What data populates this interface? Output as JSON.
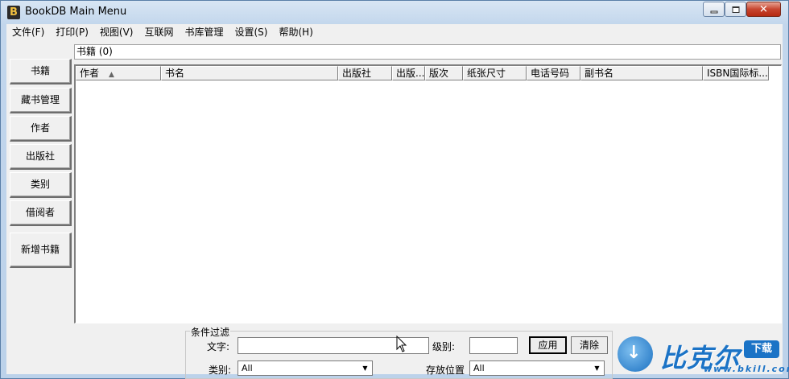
{
  "window": {
    "title": "BookDB Main Menu",
    "app_icon_letter": "B",
    "close_glyph": "✕"
  },
  "menu": [
    "文件(F)",
    "打印(P)",
    "视图(V)",
    "互联网",
    "书库管理",
    "设置(S)",
    "帮助(H)"
  ],
  "nav": [
    "书籍",
    "藏书管理",
    "作者",
    "出版社",
    "类别",
    "借阅者",
    "新增书籍"
  ],
  "list": {
    "caption": "书籍 (0)",
    "sort_indicator": "▲",
    "columns": [
      "作者",
      "书名",
      "出版社",
      "出版...",
      "版次",
      "纸张尺寸",
      "电话号码",
      "副书名",
      "ISBN国际标..."
    ]
  },
  "filter": {
    "legend": "条件过滤",
    "text_label": "文字:",
    "text_value": "",
    "level_label": "级别:",
    "level_value": "",
    "apply_label": "应用",
    "clear_label": "清除",
    "category_label": "类别:",
    "category_value": "All",
    "location_label": "存放位置",
    "location_value": "All"
  },
  "watermark": {
    "brand": "比克尔",
    "badge": "下载",
    "url": "www.bkill.com"
  }
}
